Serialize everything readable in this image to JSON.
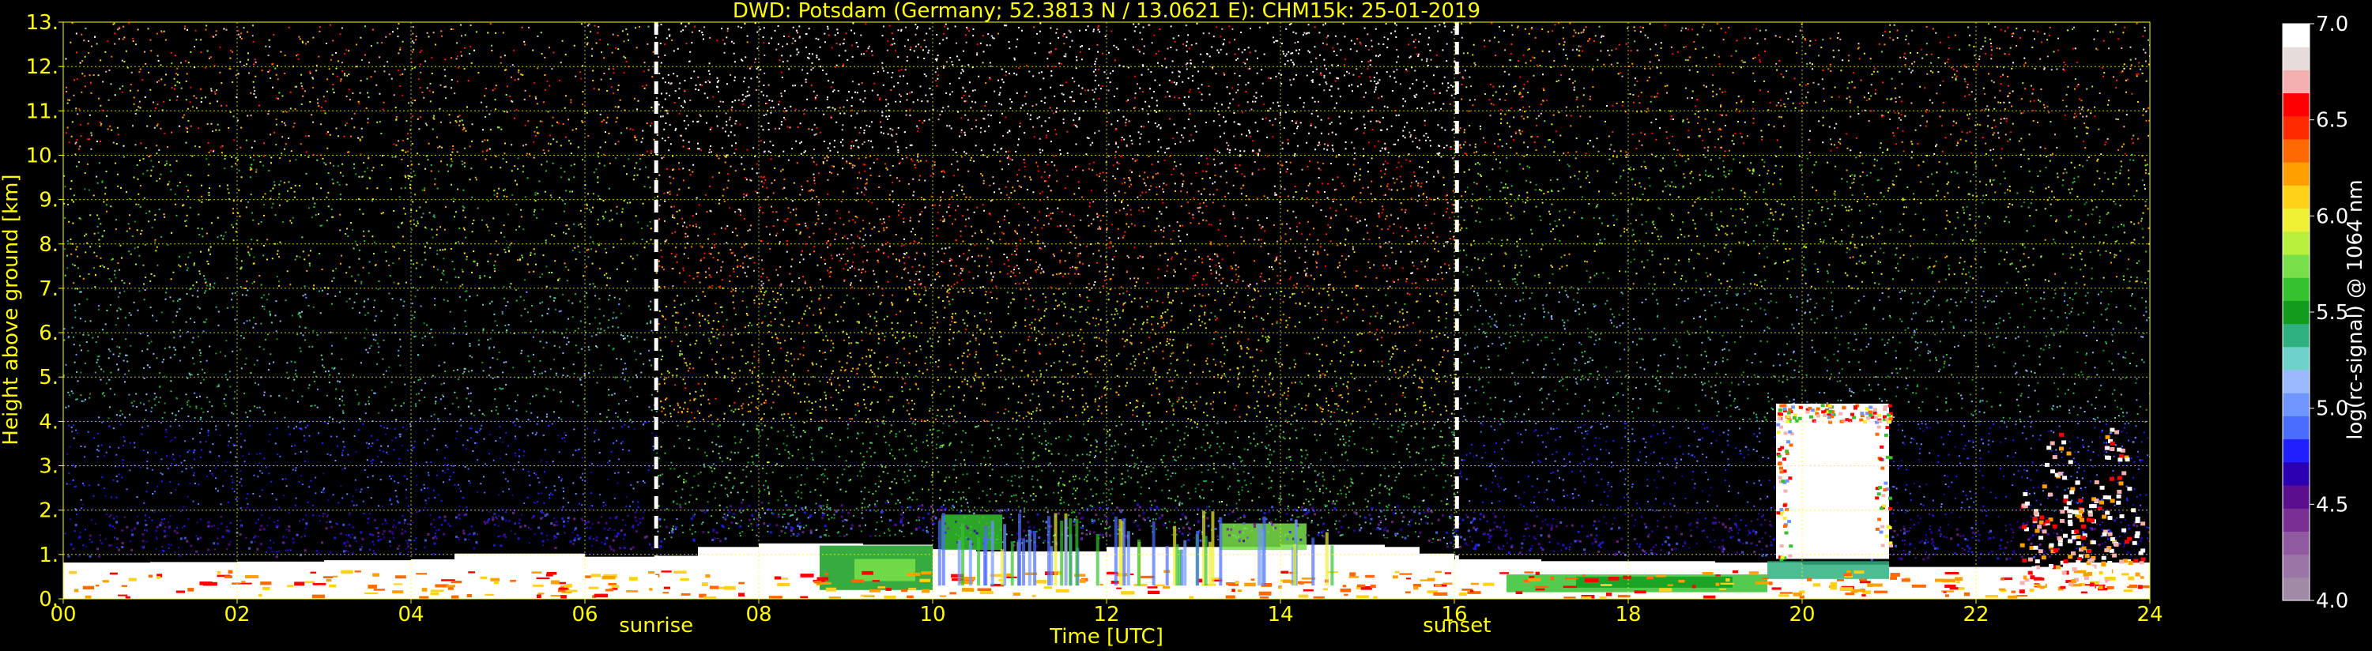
{
  "chart_data": {
    "type": "heatmap",
    "title": "DWD: Potsdam (Germany; 52.3813 N / 13.0621 E):    CHM15k: 25-01-2019",
    "xlabel": "Time [UTC]",
    "ylabel": "Height above ground [km]",
    "xlim": [
      0,
      24
    ],
    "ylim": [
      0,
      13
    ],
    "x_ticks": [
      0,
      2,
      4,
      6,
      8,
      10,
      12,
      14,
      16,
      18,
      20,
      22,
      24
    ],
    "x_tick_labels": [
      "00",
      "02",
      "04",
      "06",
      "08",
      "10",
      "12",
      "14",
      "16",
      "18",
      "20",
      "22",
      "24"
    ],
    "y_ticks": [
      0,
      1,
      2,
      3,
      4,
      5,
      6,
      7,
      8,
      9,
      10,
      11,
      12,
      13
    ],
    "y_tick_labels": [
      "0.",
      "1.",
      "2.",
      "3.",
      "4.",
      "5.",
      "6.",
      "7.",
      "8.",
      "9.",
      "10.",
      "11.",
      "12.",
      "13."
    ],
    "grid": true,
    "grid_color": "#ffff00",
    "colorbar": {
      "label": "log(rc-signal) @ 1064 nm",
      "range": [
        4.0,
        7.0
      ],
      "ticks": [
        4.0,
        4.5,
        5.0,
        5.5,
        6.0,
        6.5,
        7.0
      ],
      "tick_labels": [
        "4.0",
        "4.5",
        "5.0",
        "5.5",
        "6.0",
        "6.5",
        "7.0"
      ],
      "colors": [
        "#a08aa6",
        "#9a75a6",
        "#8f5aa0",
        "#7a2f95",
        "#5a0f8f",
        "#2a00b0",
        "#2020ff",
        "#4a6cff",
        "#6f96ff",
        "#9ab9ff",
        "#6fd2c8",
        "#2fb07f",
        "#129c1e",
        "#35c22f",
        "#7ae04a",
        "#b8f03e",
        "#f0f034",
        "#ffd21a",
        "#ffa000",
        "#ff6a00",
        "#ff2a00",
        "#ff0000",
        "#f4b0b0",
        "#e6dcdc",
        "#ffffff"
      ]
    },
    "events": [
      {
        "label": "sunrise",
        "time": 6.82
      },
      {
        "label": "sunset",
        "time": 16.03
      }
    ],
    "cloud_base_trace": [
      [
        0,
        0.85
      ],
      [
        1,
        0.86
      ],
      [
        2,
        0.87
      ],
      [
        3,
        0.9
      ],
      [
        4,
        0.92
      ],
      [
        4.5,
        1.05
      ],
      [
        5.2,
        1.1
      ],
      [
        6.0,
        1.05
      ],
      [
        6.5,
        0.98
      ],
      [
        6.8,
        1.0
      ],
      [
        7.3,
        1.2
      ],
      [
        8.0,
        1.3
      ],
      [
        8.6,
        1.28
      ],
      [
        9.2,
        1.3
      ],
      [
        10.0,
        1.25
      ],
      [
        10.5,
        1.15
      ],
      [
        11.2,
        1.1
      ],
      [
        12.0,
        1.2
      ],
      [
        12.6,
        1.35
      ],
      [
        13.2,
        1.2
      ],
      [
        14.0,
        1.25
      ],
      [
        14.6,
        1.3
      ],
      [
        15.2,
        1.25
      ],
      [
        15.6,
        1.2
      ],
      [
        16.0,
        1.05
      ],
      [
        17.0,
        0.92
      ],
      [
        18.0,
        0.88
      ],
      [
        19.0,
        0.9
      ],
      [
        20.0,
        0.85
      ],
      [
        21.0,
        0.8
      ],
      [
        22.0,
        0.75
      ],
      [
        23.0,
        0.85
      ],
      [
        24.0,
        0.9
      ]
    ],
    "cloud_patches": [
      {
        "t0": 19.7,
        "t1": 21.0,
        "h0": 0.9,
        "h1": 4.4,
        "desc": "dense white core"
      },
      {
        "t0": 22.5,
        "t1": 23.9,
        "h0": 0.3,
        "h1": 3.9,
        "desc": "convective cells"
      }
    ],
    "noise_regimes": [
      {
        "t0": 0,
        "t1": 6.82,
        "level": "low"
      },
      {
        "t0": 6.82,
        "t1": 16.03,
        "level": "high"
      },
      {
        "t0": 16.03,
        "t1": 24,
        "level": "low"
      }
    ]
  }
}
